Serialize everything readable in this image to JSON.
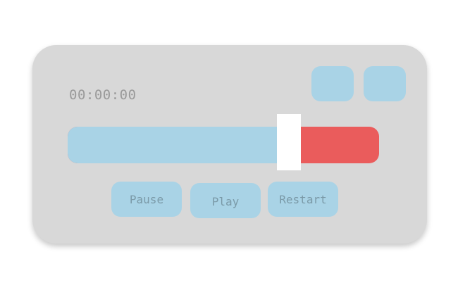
{
  "timer": {
    "display": "00:00:00"
  },
  "progress": {
    "fraction": 0.68,
    "fill_color": "#a9d3e6",
    "remaining_color": "#ea5c5c",
    "handle_color": "#ffffff"
  },
  "controls": {
    "pause_label": "Pause",
    "play_label": "Play",
    "restart_label": "Restart"
  },
  "colors": {
    "panel": "#d8d8d8",
    "button": "#a9d3e6",
    "button_text": "#7b9aa8",
    "timer_text": "#9a9a9a"
  }
}
